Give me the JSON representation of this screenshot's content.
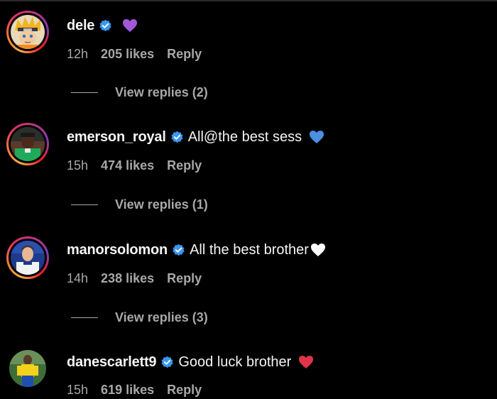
{
  "comments": [
    {
      "username": "dele",
      "text": "",
      "emoji": "purple-heart",
      "time": "12h",
      "likes": "205 likes",
      "reply": "Reply",
      "view_replies": "View replies (2)"
    },
    {
      "username": "emerson_royal",
      "text": "All@the best sess",
      "emoji": "blue-heart",
      "time": "15h",
      "likes": "474 likes",
      "reply": "Reply",
      "view_replies": "View replies (1)"
    },
    {
      "username": "manorsolomon",
      "text": "All the best brother",
      "emoji": "white-heart",
      "time": "14h",
      "likes": "238 likes",
      "reply": "Reply",
      "view_replies": "View replies (3)"
    },
    {
      "username": "danescarlett9",
      "text": "Good luck brother",
      "emoji": "red-heart",
      "time": "15h",
      "likes": "619 likes",
      "reply": "Reply"
    }
  ],
  "colors": {
    "background": "#000000",
    "primary_text": "#f5f5f5",
    "secondary_text": "#a8a8a8",
    "verified_badge": "#3897f0",
    "purple_heart": "#a259d9",
    "blue_heart": "#4a8fe0",
    "white_heart": "#ffffff",
    "red_heart": "#e0344a"
  }
}
